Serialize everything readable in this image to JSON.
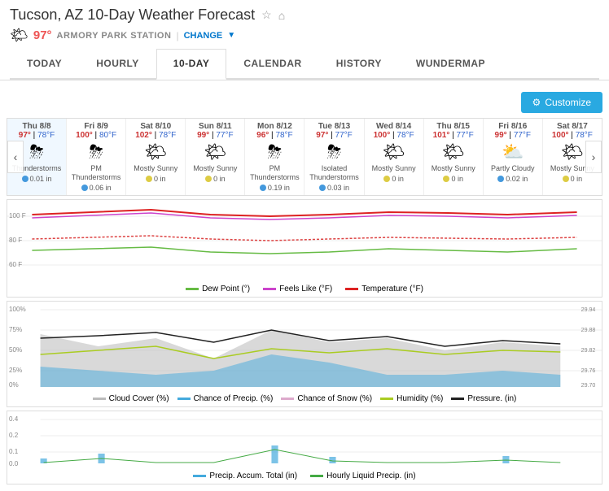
{
  "header": {
    "title": "Tucson, AZ 10-Day Weather Forecast",
    "location": "97°",
    "station": "ARMORY PARK STATION",
    "change_label": "CHANGE"
  },
  "nav": {
    "tabs": [
      {
        "id": "today",
        "label": "TODAY"
      },
      {
        "id": "hourly",
        "label": "HOURLY"
      },
      {
        "id": "10day",
        "label": "10-DAY",
        "active": true
      },
      {
        "id": "calendar",
        "label": "CALENDAR"
      },
      {
        "id": "history",
        "label": "HISTORY"
      },
      {
        "id": "wundermap",
        "label": "WUNDERMAP"
      }
    ]
  },
  "toolbar": {
    "customize_label": "Customize"
  },
  "forecast": {
    "days": [
      {
        "day": "Thu 8/8",
        "high": "97°",
        "low": "78°F",
        "icon": "⛈",
        "desc": "Thunderstorms",
        "precip": "0.01 in",
        "precip_type": "blue"
      },
      {
        "day": "Fri 8/9",
        "high": "100°",
        "low": "80°F",
        "icon": "⛈",
        "desc": "PM Thunderstorms",
        "precip": "0.06 in",
        "precip_type": "blue"
      },
      {
        "day": "Sat 8/10",
        "high": "102°",
        "low": "78°F",
        "icon": "🌤",
        "desc": "Mostly Sunny",
        "precip": "0 in",
        "precip_type": "yellow"
      },
      {
        "day": "Sun 8/11",
        "high": "99°",
        "low": "77°F",
        "icon": "🌤",
        "desc": "Mostly Sunny",
        "precip": "0 in",
        "precip_type": "yellow"
      },
      {
        "day": "Mon 8/12",
        "high": "96°",
        "low": "78°F",
        "icon": "⛈",
        "desc": "PM Thunderstorms",
        "precip": "0.19 in",
        "precip_type": "blue"
      },
      {
        "day": "Tue 8/13",
        "high": "97°",
        "low": "77°F",
        "icon": "⛈",
        "desc": "Isolated Thunderstorms",
        "precip": "0.03 in",
        "precip_type": "blue"
      },
      {
        "day": "Wed 8/14",
        "high": "100°",
        "low": "78°F",
        "icon": "🌤",
        "desc": "Mostly Sunny",
        "precip": "0 in",
        "precip_type": "yellow"
      },
      {
        "day": "Thu 8/15",
        "high": "101°",
        "low": "77°F",
        "icon": "🌤",
        "desc": "Mostly Sunny",
        "precip": "0 in",
        "precip_type": "yellow"
      },
      {
        "day": "Fri 8/16",
        "high": "99°",
        "low": "77°F",
        "icon": "⛅",
        "desc": "Partly Cloudy",
        "precip": "0.02 in",
        "precip_type": "blue"
      },
      {
        "day": "Sat 8/17",
        "high": "100°",
        "low": "78°F",
        "icon": "🌤",
        "desc": "Mostly Sunny",
        "precip": "0 in",
        "precip_type": "yellow"
      }
    ]
  },
  "legend": {
    "temp": [
      {
        "label": "Dew Point (°)",
        "color": "#66bb44"
      },
      {
        "label": "Feels Like (°F)",
        "color": "#cc44cc"
      },
      {
        "label": "Temperature (°F)",
        "color": "#dd2222"
      }
    ],
    "precip": [
      {
        "label": "Cloud Cover (%)",
        "color": "#bbbbbb"
      },
      {
        "label": "Chance of Precip. (%)",
        "color": "#44aadd"
      },
      {
        "label": "Chance of Snow (%)",
        "color": "#ddaacc"
      },
      {
        "label": "Humidity (%)",
        "color": "#aacc22"
      },
      {
        "label": "Pressure. (in)",
        "color": "#222222"
      }
    ],
    "rain": [
      {
        "label": "Precip. Accum. Total (in)",
        "color": "#44aadd"
      },
      {
        "label": "Hourly Liquid Precip. (in)",
        "color": "#44aa44"
      }
    ]
  }
}
